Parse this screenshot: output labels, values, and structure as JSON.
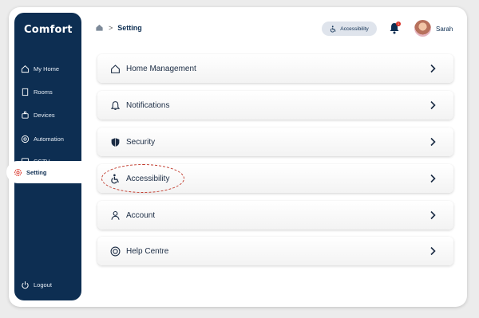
{
  "app": {
    "brand": "Comfort"
  },
  "sidebar": {
    "items": [
      {
        "label": "My Home",
        "icon": "home-icon"
      },
      {
        "label": "Rooms",
        "icon": "door-icon"
      },
      {
        "label": "Devices",
        "icon": "device-icon"
      },
      {
        "label": "Automation",
        "icon": "automation-icon"
      },
      {
        "label": "CCTV",
        "icon": "camera-icon"
      },
      {
        "label": "Setting",
        "icon": "gear-icon",
        "active": true
      }
    ],
    "logout": {
      "label": "Logout",
      "icon": "power-icon"
    }
  },
  "header": {
    "breadcrumb": {
      "current": "Setting"
    },
    "accessibility_label": "Accessibility",
    "notifications_count": "1",
    "user_name": "Sarah"
  },
  "settings": {
    "rows": [
      {
        "label": "Home Management",
        "icon": "home-icon"
      },
      {
        "label": "Notifications",
        "icon": "bell-icon"
      },
      {
        "label": "Security",
        "icon": "shield-icon"
      },
      {
        "label": "Accessibility",
        "icon": "wheelchair-icon",
        "highlighted": true
      },
      {
        "label": "Account",
        "icon": "user-icon"
      },
      {
        "label": "Help Centre",
        "icon": "lifebuoy-icon"
      }
    ]
  },
  "colors": {
    "sidebar": "#0d2e52",
    "accent": "#0d2e52",
    "highlight": "#c0392b",
    "badge": "#d93025"
  }
}
